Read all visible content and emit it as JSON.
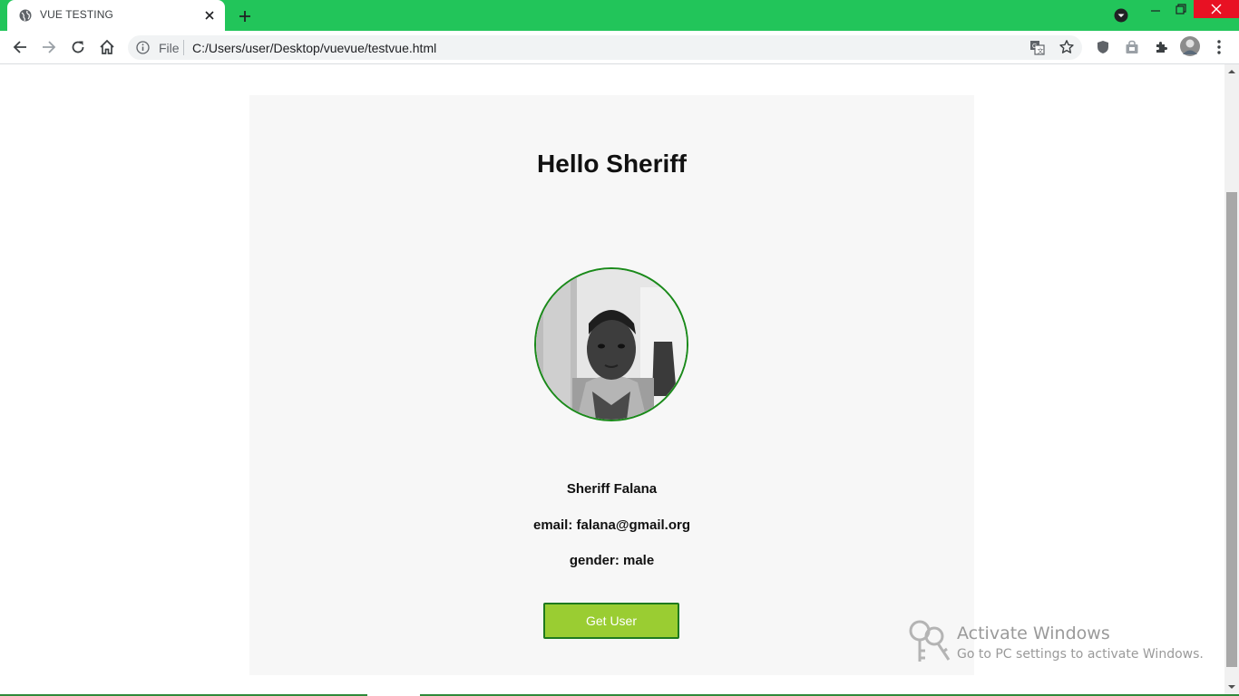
{
  "browser": {
    "tab_title": "VUE TESTING",
    "omnibox_scheme": "File",
    "omnibox_url": "C:/Users/user/Desktop/vuevue/testvue.html",
    "accent_color": "#22c55a"
  },
  "page": {
    "greeting": "Hello Sheriff",
    "user_name": "Sheriff Falana",
    "email_line": "email: falana@gmail.org",
    "gender_line": "gender: male",
    "button_label": "Get User",
    "button_color": "#9acd32"
  },
  "watermark": {
    "title": "Activate Windows",
    "subtitle": "Go to PC settings to activate Windows."
  },
  "icons": [
    "globe-icon",
    "close-icon",
    "plus-icon",
    "dropdown-icon",
    "minimize-icon",
    "restore-icon",
    "back-icon",
    "forward-icon",
    "reload-icon",
    "home-icon",
    "info-icon",
    "translate-icon",
    "star-icon",
    "shield-icon",
    "lock-icon",
    "extensions-icon",
    "profile-avatar",
    "menu-icon",
    "key-icon"
  ]
}
